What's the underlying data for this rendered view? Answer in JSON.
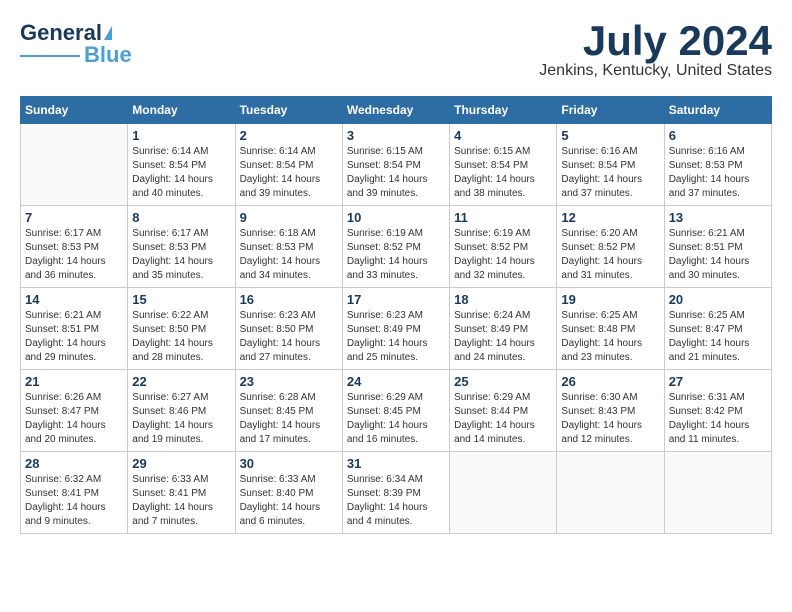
{
  "logo": {
    "text1": "General",
    "text2": "Blue"
  },
  "title": "July 2024",
  "subtitle": "Jenkins, Kentucky, United States",
  "days_of_week": [
    "Sunday",
    "Monday",
    "Tuesday",
    "Wednesday",
    "Thursday",
    "Friday",
    "Saturday"
  ],
  "weeks": [
    [
      {
        "day": "",
        "info": ""
      },
      {
        "day": "1",
        "info": "Sunrise: 6:14 AM\nSunset: 8:54 PM\nDaylight: 14 hours\nand 40 minutes."
      },
      {
        "day": "2",
        "info": "Sunrise: 6:14 AM\nSunset: 8:54 PM\nDaylight: 14 hours\nand 39 minutes."
      },
      {
        "day": "3",
        "info": "Sunrise: 6:15 AM\nSunset: 8:54 PM\nDaylight: 14 hours\nand 39 minutes."
      },
      {
        "day": "4",
        "info": "Sunrise: 6:15 AM\nSunset: 8:54 PM\nDaylight: 14 hours\nand 38 minutes."
      },
      {
        "day": "5",
        "info": "Sunrise: 6:16 AM\nSunset: 8:54 PM\nDaylight: 14 hours\nand 37 minutes."
      },
      {
        "day": "6",
        "info": "Sunrise: 6:16 AM\nSunset: 8:53 PM\nDaylight: 14 hours\nand 37 minutes."
      }
    ],
    [
      {
        "day": "7",
        "info": "Sunrise: 6:17 AM\nSunset: 8:53 PM\nDaylight: 14 hours\nand 36 minutes."
      },
      {
        "day": "8",
        "info": "Sunrise: 6:17 AM\nSunset: 8:53 PM\nDaylight: 14 hours\nand 35 minutes."
      },
      {
        "day": "9",
        "info": "Sunrise: 6:18 AM\nSunset: 8:53 PM\nDaylight: 14 hours\nand 34 minutes."
      },
      {
        "day": "10",
        "info": "Sunrise: 6:19 AM\nSunset: 8:52 PM\nDaylight: 14 hours\nand 33 minutes."
      },
      {
        "day": "11",
        "info": "Sunrise: 6:19 AM\nSunset: 8:52 PM\nDaylight: 14 hours\nand 32 minutes."
      },
      {
        "day": "12",
        "info": "Sunrise: 6:20 AM\nSunset: 8:52 PM\nDaylight: 14 hours\nand 31 minutes."
      },
      {
        "day": "13",
        "info": "Sunrise: 6:21 AM\nSunset: 8:51 PM\nDaylight: 14 hours\nand 30 minutes."
      }
    ],
    [
      {
        "day": "14",
        "info": "Sunrise: 6:21 AM\nSunset: 8:51 PM\nDaylight: 14 hours\nand 29 minutes."
      },
      {
        "day": "15",
        "info": "Sunrise: 6:22 AM\nSunset: 8:50 PM\nDaylight: 14 hours\nand 28 minutes."
      },
      {
        "day": "16",
        "info": "Sunrise: 6:23 AM\nSunset: 8:50 PM\nDaylight: 14 hours\nand 27 minutes."
      },
      {
        "day": "17",
        "info": "Sunrise: 6:23 AM\nSunset: 8:49 PM\nDaylight: 14 hours\nand 25 minutes."
      },
      {
        "day": "18",
        "info": "Sunrise: 6:24 AM\nSunset: 8:49 PM\nDaylight: 14 hours\nand 24 minutes."
      },
      {
        "day": "19",
        "info": "Sunrise: 6:25 AM\nSunset: 8:48 PM\nDaylight: 14 hours\nand 23 minutes."
      },
      {
        "day": "20",
        "info": "Sunrise: 6:25 AM\nSunset: 8:47 PM\nDaylight: 14 hours\nand 21 minutes."
      }
    ],
    [
      {
        "day": "21",
        "info": "Sunrise: 6:26 AM\nSunset: 8:47 PM\nDaylight: 14 hours\nand 20 minutes."
      },
      {
        "day": "22",
        "info": "Sunrise: 6:27 AM\nSunset: 8:46 PM\nDaylight: 14 hours\nand 19 minutes."
      },
      {
        "day": "23",
        "info": "Sunrise: 6:28 AM\nSunset: 8:45 PM\nDaylight: 14 hours\nand 17 minutes."
      },
      {
        "day": "24",
        "info": "Sunrise: 6:29 AM\nSunset: 8:45 PM\nDaylight: 14 hours\nand 16 minutes."
      },
      {
        "day": "25",
        "info": "Sunrise: 6:29 AM\nSunset: 8:44 PM\nDaylight: 14 hours\nand 14 minutes."
      },
      {
        "day": "26",
        "info": "Sunrise: 6:30 AM\nSunset: 8:43 PM\nDaylight: 14 hours\nand 12 minutes."
      },
      {
        "day": "27",
        "info": "Sunrise: 6:31 AM\nSunset: 8:42 PM\nDaylight: 14 hours\nand 11 minutes."
      }
    ],
    [
      {
        "day": "28",
        "info": "Sunrise: 6:32 AM\nSunset: 8:41 PM\nDaylight: 14 hours\nand 9 minutes."
      },
      {
        "day": "29",
        "info": "Sunrise: 6:33 AM\nSunset: 8:41 PM\nDaylight: 14 hours\nand 7 minutes."
      },
      {
        "day": "30",
        "info": "Sunrise: 6:33 AM\nSunset: 8:40 PM\nDaylight: 14 hours\nand 6 minutes."
      },
      {
        "day": "31",
        "info": "Sunrise: 6:34 AM\nSunset: 8:39 PM\nDaylight: 14 hours\nand 4 minutes."
      },
      {
        "day": "",
        "info": ""
      },
      {
        "day": "",
        "info": ""
      },
      {
        "day": "",
        "info": ""
      }
    ]
  ]
}
